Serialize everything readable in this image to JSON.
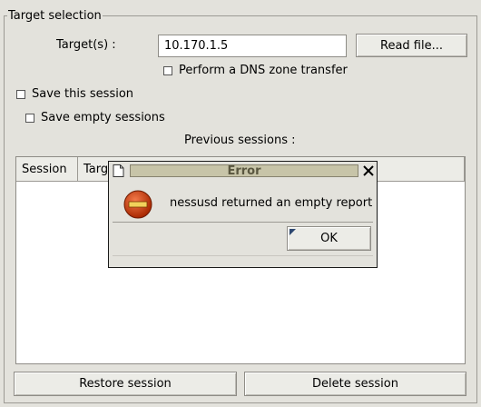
{
  "target_selection": {
    "legend": "Target selection",
    "targets_label": "Target(s) :",
    "targets_value": "10.170.1.5",
    "read_file_label": "Read file...",
    "dns_zone_label": "Perform a DNS zone transfer",
    "save_session_label": "Save this session",
    "save_empty_label": "Save empty sessions",
    "previous_sessions_label": "Previous sessions :",
    "columns": [
      "Session",
      "Targets"
    ],
    "restore_label": "Restore session",
    "delete_label": "Delete session"
  },
  "dialog": {
    "title": "Error",
    "message": "nessusd returned an empty report",
    "ok_label": "OK",
    "close_glyph": "✕",
    "icon": "error-stop-icon"
  },
  "colors": {
    "background": "#e3e2dc",
    "title_bar": "#c7c4a8",
    "error_icon": "#cc3300"
  }
}
